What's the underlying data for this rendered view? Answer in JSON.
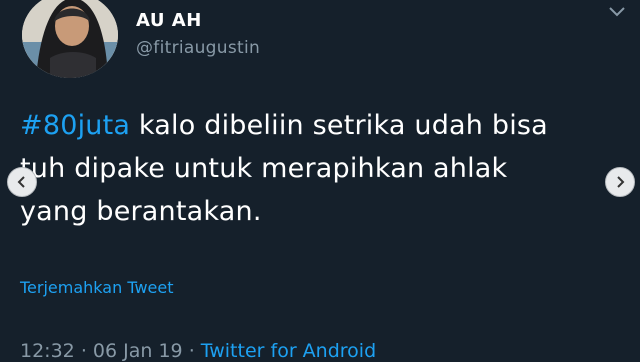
{
  "user": {
    "display_name": "AU AH",
    "handle": "@fitriaugustin"
  },
  "tweet": {
    "hashtag": "#80juta",
    "line1_rest": " kalo dibeliin setrika udah bisa",
    "line2": "tuh dipake untuk merapihkan ahlak",
    "line3": "yang berantakan.",
    "translate_label": "Terjemahkan Tweet",
    "time": "12:32",
    "date": "06 Jan 19",
    "separator": "·",
    "source": "Twitter for Android"
  },
  "colors": {
    "background": "#15202b",
    "accent": "#1da1f2",
    "secondary_text": "#8899a6"
  },
  "icons": {
    "menu": "chevron-down-icon",
    "prev": "chevron-left-icon",
    "next": "chevron-right-icon"
  }
}
